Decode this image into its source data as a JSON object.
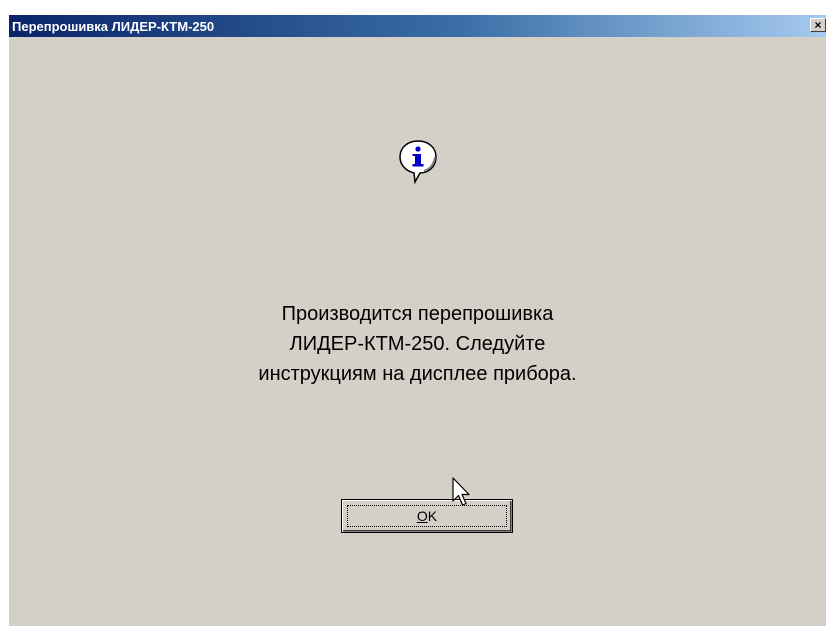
{
  "window": {
    "title": "Перепрошивка ЛИДЕР-КТМ-250",
    "close_glyph": "×"
  },
  "dialog": {
    "icon": "information-icon",
    "message_lines": [
      "Производится перепрошивка",
      "ЛИДЕР-КТМ-250. Следуйте",
      "инструкциям на дисплее прибора."
    ],
    "ok_button": {
      "label_mnemonic": "O",
      "label_rest": "K"
    }
  },
  "colors": {
    "title_start": "#0a246a",
    "title_end": "#a6caf0",
    "face": "#d4d0c8",
    "icon_blue": "#0000cc"
  }
}
